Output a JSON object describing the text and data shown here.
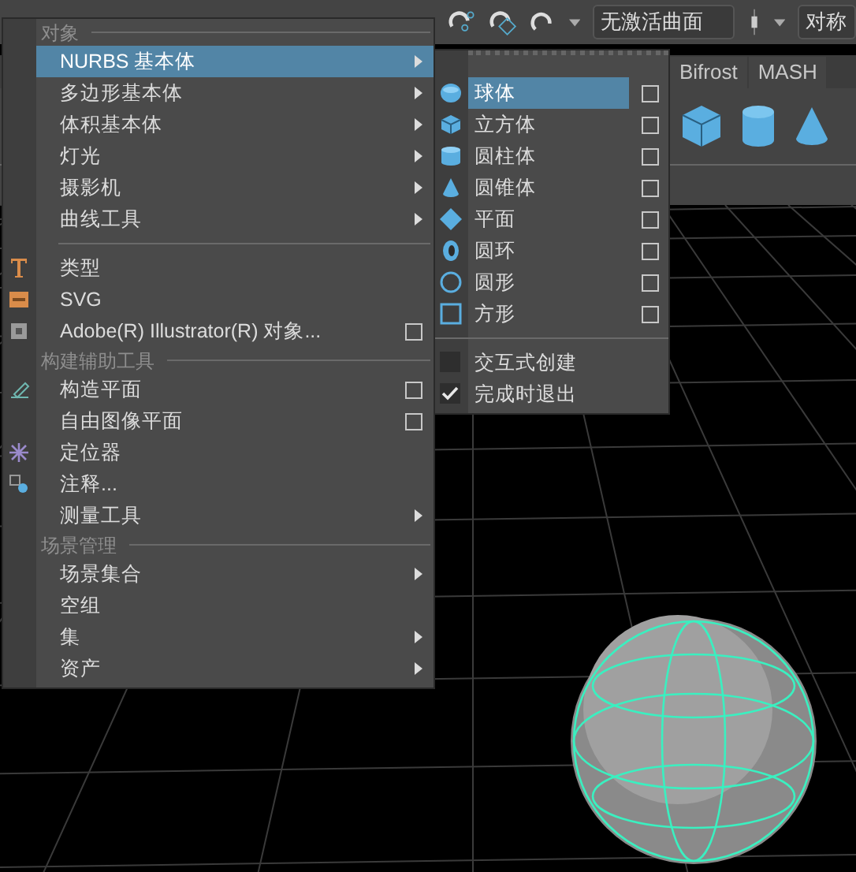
{
  "toolbar": {
    "surface_field": "无激活曲面",
    "symmetry_field": "对称"
  },
  "shelf_tabs": [
    "Bifrost",
    "MASH"
  ],
  "menu": {
    "sections": [
      {
        "header": "对象",
        "items": [
          {
            "label": "NURBS 基本体",
            "kind": "submenu",
            "selected": true
          },
          {
            "label": "多边形基本体",
            "kind": "submenu",
            "selected": false
          },
          {
            "label": "体积基本体",
            "kind": "submenu",
            "selected": false
          },
          {
            "label": "灯光",
            "kind": "submenu",
            "selected": false
          },
          {
            "label": "摄影机",
            "kind": "submenu",
            "selected": false
          },
          {
            "label": "曲线工具",
            "kind": "submenu",
            "selected": false
          }
        ]
      },
      {
        "items": [
          {
            "label": "类型",
            "kind": "plain",
            "selected": false
          },
          {
            "label": "SVG",
            "kind": "plain",
            "selected": false
          },
          {
            "label": "Adobe(R) Illustrator(R) 对象...",
            "kind": "option",
            "selected": false
          }
        ]
      },
      {
        "header": "构建辅助工具",
        "items": [
          {
            "label": "构造平面",
            "kind": "option",
            "selected": false
          },
          {
            "label": "自由图像平面",
            "kind": "option",
            "selected": false
          },
          {
            "label": "定位器",
            "kind": "plain",
            "selected": false
          },
          {
            "label": "注释...",
            "kind": "plain",
            "selected": false
          },
          {
            "label": "测量工具",
            "kind": "submenu",
            "selected": false
          }
        ]
      },
      {
        "header": "场景管理",
        "items": [
          {
            "label": "场景集合",
            "kind": "submenu",
            "selected": false
          },
          {
            "label": "空组",
            "kind": "plain",
            "selected": false
          },
          {
            "label": "集",
            "kind": "submenu",
            "selected": false
          },
          {
            "label": "资产",
            "kind": "submenu",
            "selected": false
          }
        ]
      }
    ]
  },
  "submenu": {
    "items": [
      {
        "label": "球体",
        "kind": "shape",
        "selected": true
      },
      {
        "label": "立方体",
        "kind": "shape",
        "selected": false
      },
      {
        "label": "圆柱体",
        "kind": "shape",
        "selected": false
      },
      {
        "label": "圆锥体",
        "kind": "shape",
        "selected": false
      },
      {
        "label": "平面",
        "kind": "shape",
        "selected": false
      },
      {
        "label": "圆环",
        "kind": "shape",
        "selected": false
      },
      {
        "label": "圆形",
        "kind": "shape",
        "selected": false
      },
      {
        "label": "方形",
        "kind": "shape",
        "selected": false
      },
      {
        "label": "交互式创建",
        "kind": "toggle",
        "checked": false
      },
      {
        "label": "完成时退出",
        "kind": "toggle",
        "checked": true
      }
    ]
  }
}
